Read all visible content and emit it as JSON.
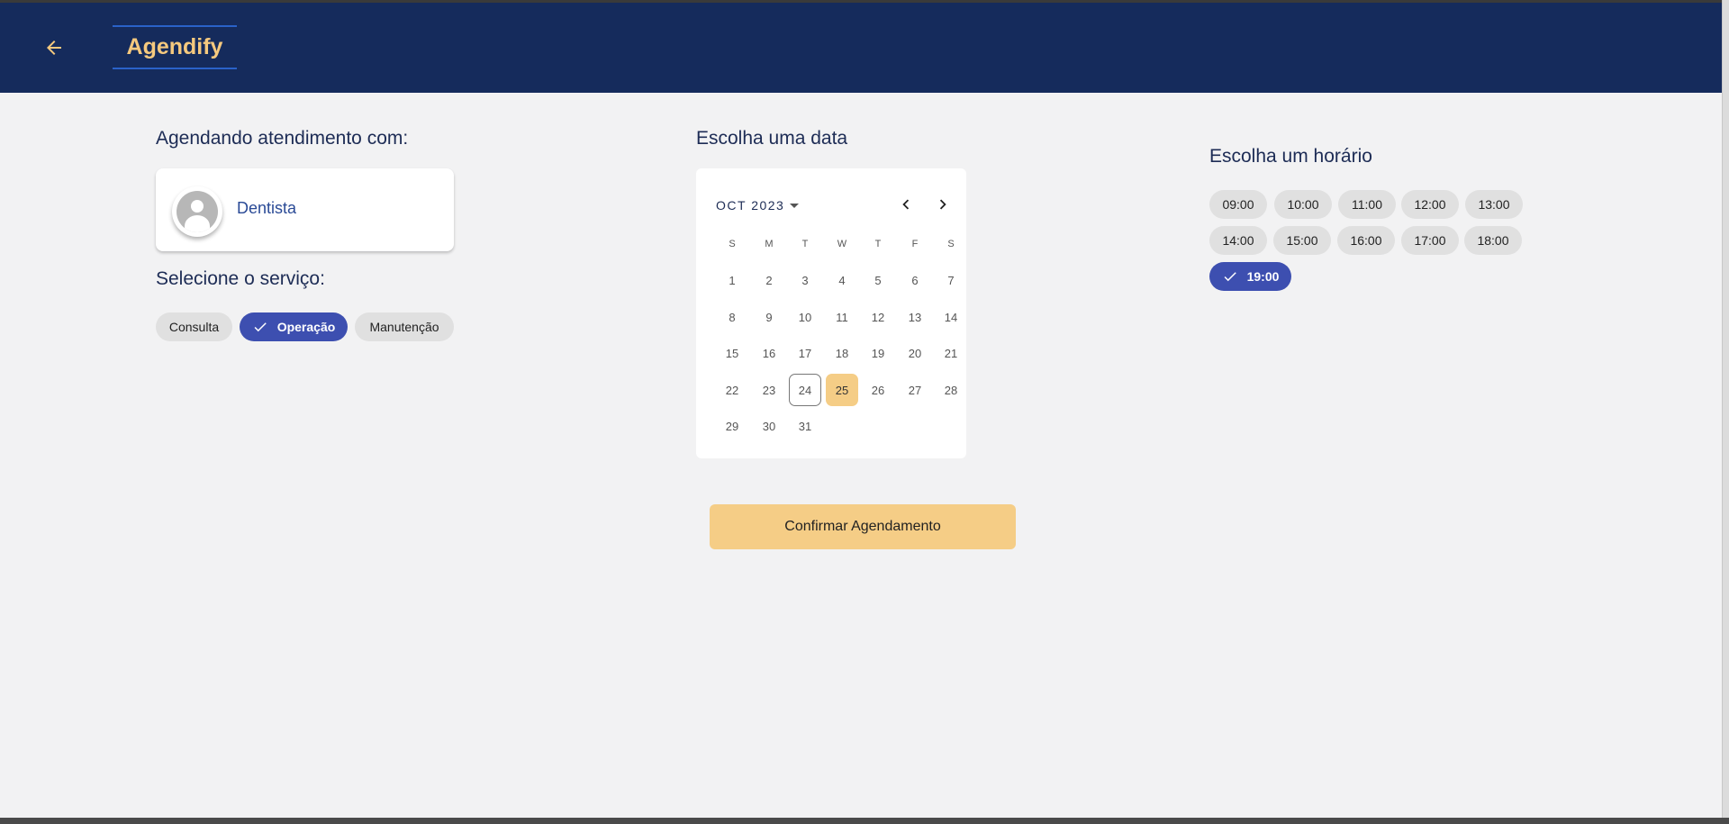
{
  "header": {
    "back_icon": "arrow-left-icon",
    "brand": "Agendify"
  },
  "professional_section": {
    "title": "Agendando atendimento com:",
    "name": "Dentista",
    "avatar_icon": "person-icon"
  },
  "service_section": {
    "title": "Selecione o serviço:",
    "services": [
      {
        "label": "Consulta",
        "selected": false
      },
      {
        "label": "Operação",
        "selected": true
      },
      {
        "label": "Manutenção",
        "selected": false
      }
    ]
  },
  "date_section": {
    "title": "Escolha uma data",
    "month_label": "OCT 2023",
    "weekdays": [
      "S",
      "M",
      "T",
      "W",
      "T",
      "F",
      "S"
    ],
    "days": [
      "1",
      "2",
      "3",
      "4",
      "5",
      "6",
      "7",
      "8",
      "9",
      "10",
      "11",
      "12",
      "13",
      "14",
      "15",
      "16",
      "17",
      "18",
      "19",
      "20",
      "21",
      "22",
      "23",
      "24",
      "25",
      "26",
      "27",
      "28",
      "29",
      "30",
      "31"
    ],
    "today": "24",
    "selected": "25"
  },
  "time_section": {
    "title": "Escolha um horário",
    "times": [
      "09:00",
      "10:00",
      "11:00",
      "12:00",
      "13:00",
      "14:00",
      "15:00",
      "16:00",
      "17:00",
      "18:00",
      "19:00"
    ],
    "selected": "19:00"
  },
  "confirm_label": "Confirmar Agendamento",
  "colors": {
    "header_bg": "#152b5c",
    "brand": "#f5c97e",
    "accent_blue": "#3d4fb0",
    "accent_yellow": "#f5cd86",
    "page_bg": "#f2f2f3"
  }
}
